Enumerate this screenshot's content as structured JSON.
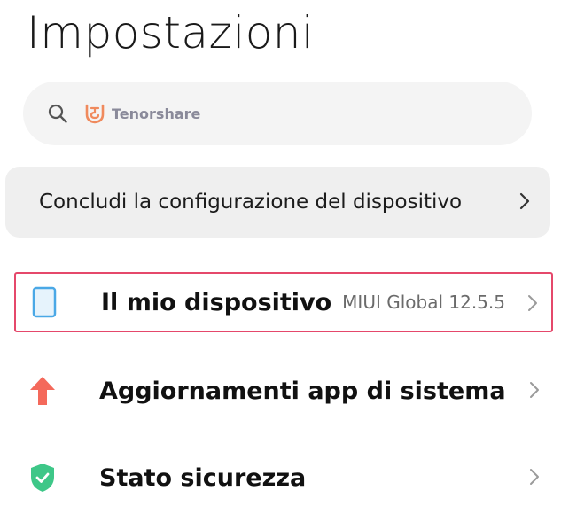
{
  "header": {
    "title": "Impostazioni"
  },
  "search": {
    "watermark_text": "Tenorshare"
  },
  "banner": {
    "label": "Concludi la configurazione del dispositivo"
  },
  "menu": [
    {
      "label": "Il mio dispositivo",
      "value": "MIUI Global 12.5.5",
      "icon": "device-icon",
      "highlighted": true
    },
    {
      "label": "Aggiornamenti app di sistema",
      "icon": "arrow-up-icon"
    },
    {
      "label": "Stato sicurezza",
      "icon": "shield-check-icon"
    }
  ],
  "colors": {
    "highlight_border": "#e5486b",
    "device_icon": "#4aa8e6",
    "update_icon": "#f4695b",
    "shield_icon": "#3ec788",
    "watermark": "#f08a5d"
  }
}
